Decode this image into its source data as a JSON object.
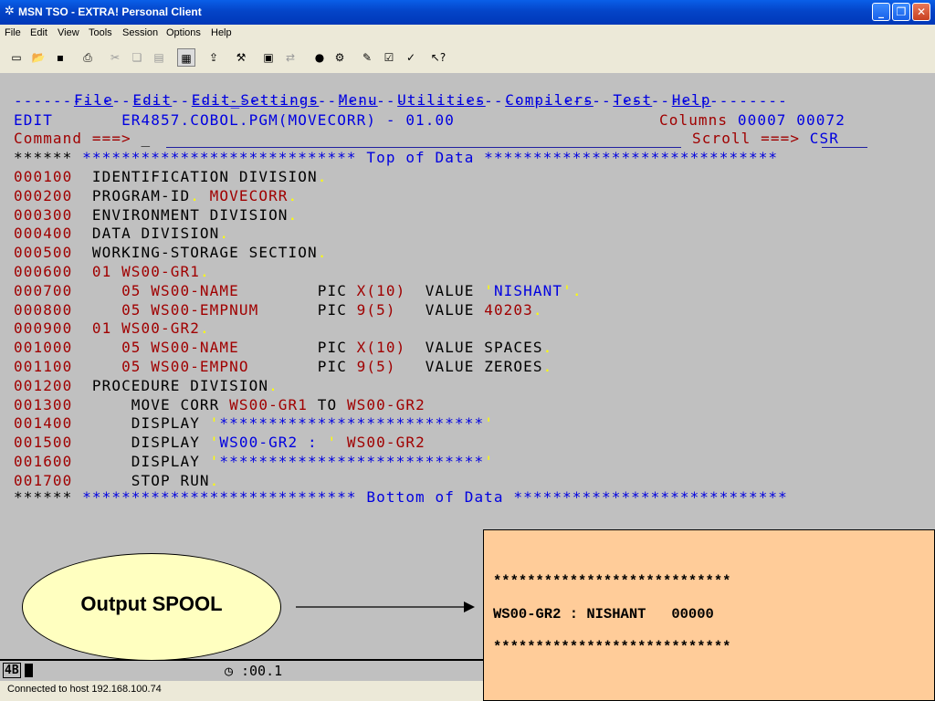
{
  "window": {
    "title": "MSN TSO - EXTRA! Personal Client",
    "buttons": {
      "minimize": "_",
      "maximize": "❐",
      "close": "✕"
    }
  },
  "menubar": [
    "File",
    "Edit",
    "View",
    "Tools",
    "Session",
    "Options",
    "Help"
  ],
  "toolbar_icons": [
    "new-icon",
    "open-icon",
    "save-icon",
    "print-icon",
    "cut-icon",
    "copy-icon",
    "paste-icon",
    "quickpad-icon",
    "open-folder-icon",
    "macro-tools-icon",
    "keyboard-map-icon",
    "file-transfer-icon",
    "record-icon",
    "macro-run-icon",
    "edit-macro-icon",
    "checklist-icon",
    "settings-icon",
    "help-pointer-icon"
  ],
  "ispf_menu": [
    "File",
    "Edit",
    "Edit_Settings",
    "Menu",
    "Utilities",
    "Compilers",
    "Test",
    "Help"
  ],
  "editor": {
    "mode": "EDIT",
    "dataset": "ER4857.COBOL.PGM(MOVECORR) - 01.00",
    "columns_label": "Columns",
    "columns_from": "00007",
    "columns_to": "00072",
    "command_label": "Command ===>",
    "command_value": "_",
    "scroll_label": "Scroll ===>",
    "scroll_value": "CSR",
    "top_marker": "******",
    "top_banner": "**************************** Top of Data ******************************",
    "bottom_banner": "**************************** Bottom of Data ****************************"
  },
  "code_lines": [
    {
      "num": "000100",
      "segs": [
        [
          "IDENTIFICATION DIVISION",
          "blk"
        ],
        [
          ".",
          "yel"
        ]
      ]
    },
    {
      "num": "000200",
      "segs": [
        [
          "PROGRAM-ID",
          "blk"
        ],
        [
          ".",
          "yel"
        ],
        [
          " MOVECORR",
          "red"
        ],
        [
          ".",
          "yel"
        ]
      ]
    },
    {
      "num": "000300",
      "segs": [
        [
          "ENVIRONMENT DIVISION",
          "blk"
        ],
        [
          ".",
          "yel"
        ]
      ]
    },
    {
      "num": "000400",
      "segs": [
        [
          "DATA DIVISION",
          "blk"
        ],
        [
          ".",
          "yel"
        ]
      ]
    },
    {
      "num": "000500",
      "segs": [
        [
          "WORKING-STORAGE SECTION",
          "blk"
        ],
        [
          ".",
          "yel"
        ]
      ]
    },
    {
      "num": "000600",
      "segs": [
        [
          "01 WS00-GR1",
          "red"
        ],
        [
          ".",
          "yel"
        ]
      ]
    },
    {
      "num": "000700",
      "segs": [
        [
          "   05 WS00-NAME",
          "red"
        ],
        [
          "        PIC ",
          "blk"
        ],
        [
          "X(10)",
          "red"
        ],
        [
          "  VALUE ",
          "blk"
        ],
        [
          "'",
          "yel"
        ],
        [
          "NISHANT",
          "blue"
        ],
        [
          "'",
          "yel"
        ],
        [
          ".",
          "yel"
        ]
      ]
    },
    {
      "num": "000800",
      "segs": [
        [
          "   05 WS00-EMPNUM",
          "red"
        ],
        [
          "      PIC ",
          "blk"
        ],
        [
          "9(5)",
          "red"
        ],
        [
          "   VALUE ",
          "blk"
        ],
        [
          "40203",
          "red"
        ],
        [
          ".",
          "yel"
        ]
      ]
    },
    {
      "num": "000900",
      "segs": [
        [
          "01 WS00-GR2",
          "red"
        ],
        [
          ".",
          "yel"
        ]
      ]
    },
    {
      "num": "001000",
      "segs": [
        [
          "   05 WS00-NAME",
          "red"
        ],
        [
          "        PIC ",
          "blk"
        ],
        [
          "X(10)",
          "red"
        ],
        [
          "  VALUE SPACES",
          "blk"
        ],
        [
          ".",
          "yel"
        ]
      ]
    },
    {
      "num": "001100",
      "segs": [
        [
          "   05 WS00-EMPNO",
          "red"
        ],
        [
          "       PIC ",
          "blk"
        ],
        [
          "9(5)",
          "red"
        ],
        [
          "   VALUE ZEROES",
          "blk"
        ],
        [
          ".",
          "yel"
        ]
      ]
    },
    {
      "num": "001200",
      "segs": [
        [
          "PROCEDURE DIVISION",
          "blk"
        ],
        [
          ".",
          "yel"
        ]
      ]
    },
    {
      "num": "001300",
      "segs": [
        [
          "    MOVE CORR ",
          "blk"
        ],
        [
          "WS00-GR1",
          "red"
        ],
        [
          " TO ",
          "blk"
        ],
        [
          "WS00-GR2",
          "red"
        ]
      ]
    },
    {
      "num": "001400",
      "segs": [
        [
          "    DISPLAY ",
          "blk"
        ],
        [
          "'",
          "yel"
        ],
        [
          "***************************",
          "blue"
        ],
        [
          "'",
          "yel"
        ]
      ]
    },
    {
      "num": "001500",
      "segs": [
        [
          "    DISPLAY ",
          "blk"
        ],
        [
          "'",
          "yel"
        ],
        [
          "WS00-GR2 : ",
          "blue"
        ],
        [
          "'",
          "yel"
        ],
        [
          " WS00-GR2",
          "red"
        ]
      ]
    },
    {
      "num": "001600",
      "segs": [
        [
          "    DISPLAY ",
          "blk"
        ],
        [
          "'",
          "yel"
        ],
        [
          "***************************",
          "blue"
        ],
        [
          "'",
          "yel"
        ]
      ]
    },
    {
      "num": "001700",
      "segs": [
        [
          "    STOP RUN",
          "blk"
        ],
        [
          ".",
          "yel"
        ]
      ]
    }
  ],
  "oia": {
    "session": "4B",
    "timer": ":00.1"
  },
  "status_bar": {
    "text": "Connected to host 192.168.100.74"
  },
  "callout": {
    "label": "Output SPOOL"
  },
  "spool": {
    "line1": "****************************",
    "line2": "WS00-GR2 : NISHANT   00000",
    "line3": "****************************"
  },
  "colors": {
    "bg": "#c0c0c0",
    "red": "#a00000",
    "blue": "#0000e0",
    "yellow": "#ffff00",
    "spool_bg": "#ffcc99",
    "bubble_bg": "#ffffc0"
  }
}
